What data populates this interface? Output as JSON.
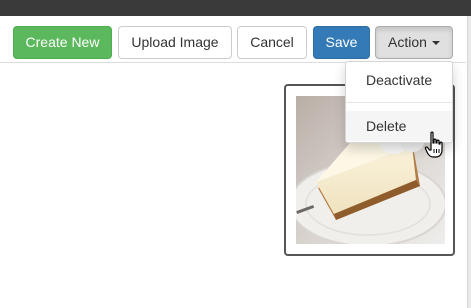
{
  "toolbar": {
    "create_new_label": "Create New",
    "upload_image_label": "Upload Image",
    "cancel_label": "Cancel",
    "save_label": "Save",
    "action_label": "Action"
  },
  "action_menu": {
    "items": [
      {
        "label": "Deactivate"
      },
      {
        "label": "Delete"
      }
    ]
  },
  "colors": {
    "create_button": "#5cb85c",
    "save_button": "#337ab7",
    "top_bar": "#3a3a3a"
  },
  "icons": {
    "caret": "chevron-down-icon",
    "cursor": "hand-pointer-icon"
  }
}
